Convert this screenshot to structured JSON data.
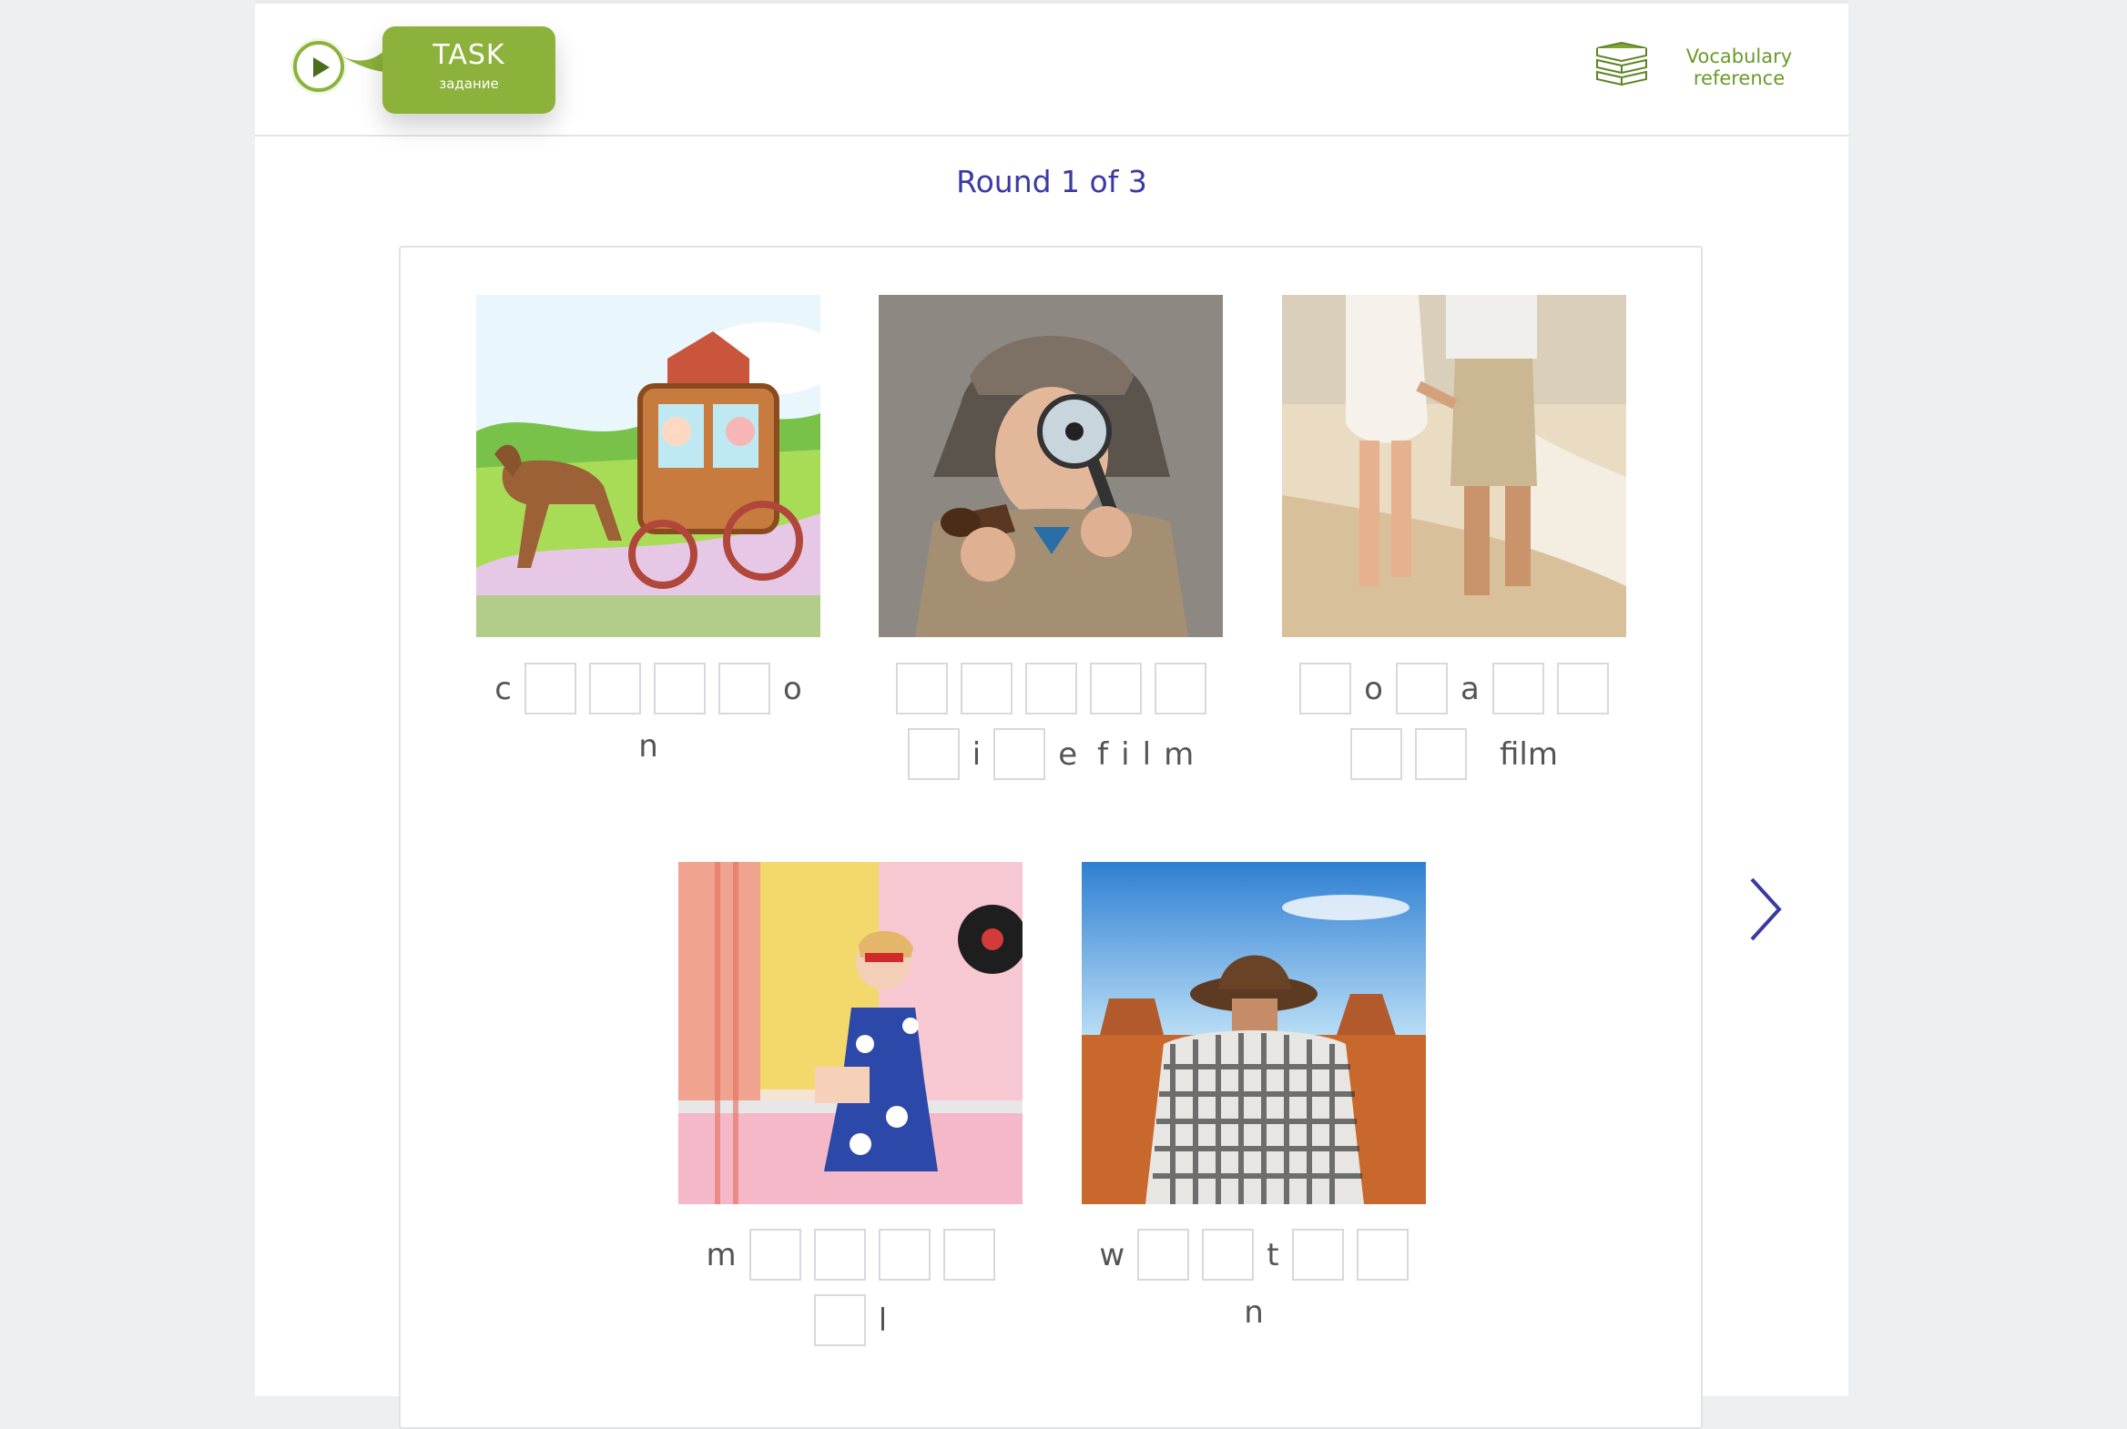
{
  "header": {
    "task_title": "TASK",
    "task_subtitle": "задание",
    "close_symbol": "×",
    "vocab_line1": "Vocabulary",
    "vocab_line2": "reference"
  },
  "round_label": "Round 1 of 3",
  "icons": [
    "play-icon",
    "close-icon",
    "books-icon",
    "chevron-right-icon"
  ],
  "colors": {
    "accent_green": "#8db23b",
    "round_blue": "#3b3aa3",
    "vocab_green": "#6a9a2a"
  },
  "puzzles": [
    {
      "image": "cartoon-horse-carriage",
      "line1": [
        "c",
        "_",
        "_",
        "_",
        "_",
        "o"
      ],
      "line2": [
        "n"
      ]
    },
    {
      "image": "detective-with-magnifier",
      "line1": [
        "_",
        "_",
        "_",
        "_",
        "_"
      ],
      "line2": [
        "_",
        "i",
        "_",
        "e",
        "f",
        "i",
        "l",
        "m"
      ]
    },
    {
      "image": "couple-walking-beach",
      "line1": [
        "_",
        "o",
        "_",
        "a",
        "_",
        "_"
      ],
      "line2": [
        "_",
        "_",
        "film"
      ]
    },
    {
      "image": "retro-woman-singing",
      "line1": [
        "m",
        "_",
        "_",
        "_",
        "_"
      ],
      "line2": [
        "_",
        "l"
      ]
    },
    {
      "image": "cowboy-in-desert",
      "line1": [
        "w",
        "_",
        "_",
        "t",
        "_",
        "_"
      ],
      "line2": [
        "n"
      ]
    }
  ]
}
